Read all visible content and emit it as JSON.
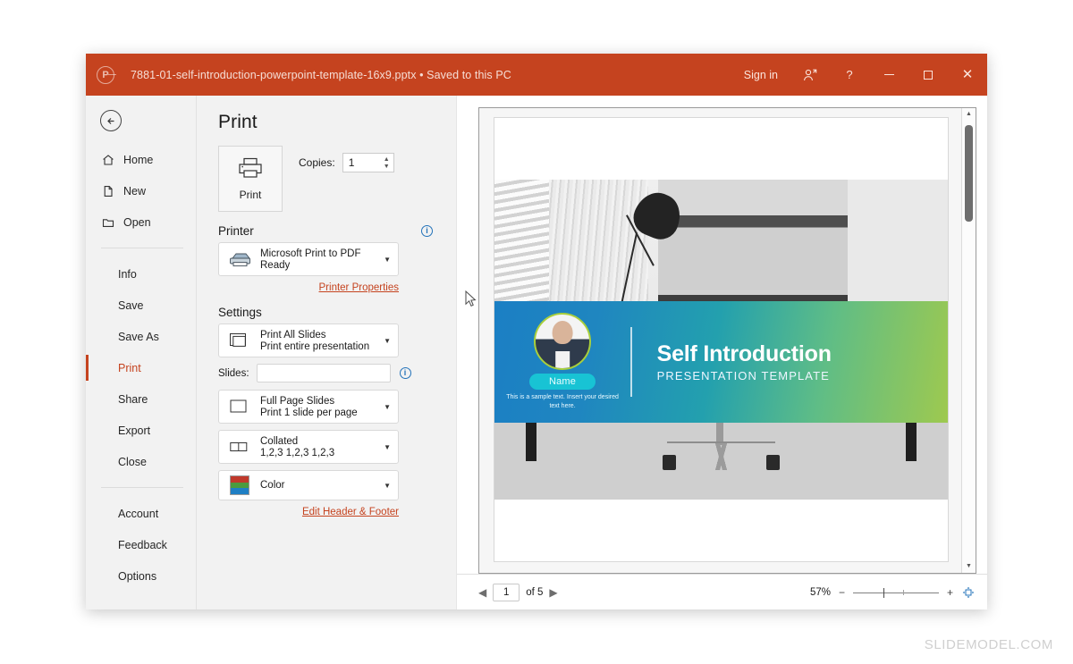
{
  "titlebar": {
    "app_icon": "powerpoint-icon",
    "document_title": "7881-01-self-introduction-powerpoint-template-16x9.pptx • Saved to this PC",
    "sign_in": "Sign in",
    "share_icon": "person-share-icon",
    "help": "?",
    "minimize": "minimize-icon",
    "maximize": "maximize-icon",
    "close": "✕"
  },
  "sidebar": {
    "back_label": "←",
    "top_items": [
      {
        "label": "Home",
        "icon": "home-icon"
      },
      {
        "label": "New",
        "icon": "page-icon"
      },
      {
        "label": "Open",
        "icon": "folder-icon"
      }
    ],
    "mid_items": [
      {
        "label": "Info"
      },
      {
        "label": "Save"
      },
      {
        "label": "Save As"
      },
      {
        "label": "Print"
      },
      {
        "label": "Share"
      },
      {
        "label": "Export"
      },
      {
        "label": "Close"
      }
    ],
    "bottom_items": [
      {
        "label": "Account"
      },
      {
        "label": "Feedback"
      },
      {
        "label": "Options"
      }
    ],
    "active_item": "Print",
    "accent_color": "#c5431f"
  },
  "print_pane": {
    "title": "Print",
    "print_button_label": "Print",
    "print_button_icon": "printer-icon",
    "copies_label": "Copies:",
    "copies_value": "1",
    "printer": {
      "heading": "Printer",
      "info_icon": "info-icon",
      "selected_name": "Microsoft Print to PDF",
      "status": "Ready",
      "icon": "printer-device-icon",
      "properties_link": "Printer Properties"
    },
    "settings": {
      "heading": "Settings",
      "range": {
        "main": "Print All Slides",
        "sub": "Print entire presentation",
        "icon": "all-slides-icon"
      },
      "slides_label": "Slides:",
      "slides_value": "",
      "slides_info_icon": "info-icon",
      "layout": {
        "main": "Full Page Slides",
        "sub": "Print 1 slide per page",
        "icon": "full-page-icon"
      },
      "collation": {
        "main": "Collated",
        "sub": "1,2,3   1,2,3   1,2,3",
        "icon": "collated-icon"
      },
      "color": {
        "main": "Color",
        "icon": "color-swatch-icon"
      },
      "header_footer_link": "Edit Header & Footer"
    }
  },
  "preview": {
    "slide": {
      "title": "Self Introduction",
      "subtitle": "PRESENTATION TEMPLATE",
      "name_badge": "Name",
      "sample_text": "This is a sample text. Insert your desired text here.",
      "avatar": "person-photo",
      "gradient_start": "#1b7fc4",
      "gradient_end": "#9ec94f",
      "badge_color": "#18c3d4"
    },
    "scrollbar": {
      "up_arrow": "▲",
      "down_arrow": "▼"
    }
  },
  "bottombar": {
    "prev_arrow": "◀",
    "next_arrow": "▶",
    "page_value": "1",
    "page_total": "of 5",
    "zoom_percent": "57%",
    "zoom_out": "−",
    "zoom_in": "+",
    "fit_icon": "fit-to-window-icon"
  },
  "watermark": "SLIDEMODEL.COM"
}
